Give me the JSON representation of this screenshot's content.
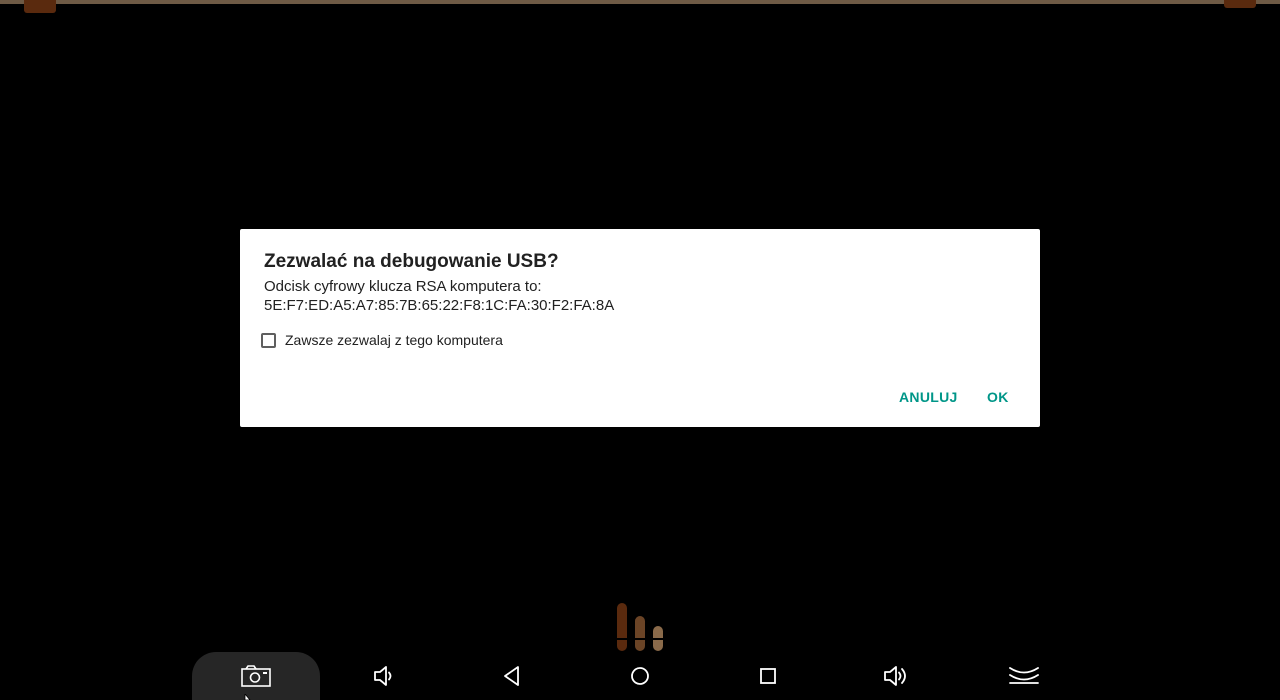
{
  "dialog": {
    "title": "Zezwalać na debugowanie USB?",
    "message": "Odcisk cyfrowy klucza RSA komputera to:\n5E:F7:ED:A5:A7:85:7B:65:22:F8:1C:FA:30:F2:FA:8A",
    "checkbox_label": "Zawsze zezwalaj z tego komputera",
    "checkbox_checked": false,
    "cancel_label": "ANULUJ",
    "ok_label": "OK"
  },
  "navbar": {
    "items": [
      {
        "icon": "screenshot-icon"
      },
      {
        "icon": "volume-down-icon"
      },
      {
        "icon": "back-icon"
      },
      {
        "icon": "home-icon"
      },
      {
        "icon": "recents-icon"
      },
      {
        "icon": "volume-up-icon"
      },
      {
        "icon": "collapse-icon"
      }
    ]
  },
  "colors": {
    "accent": "#009688",
    "logo_dark": "#5a2a0e",
    "logo_light": "#8a6a4a"
  }
}
